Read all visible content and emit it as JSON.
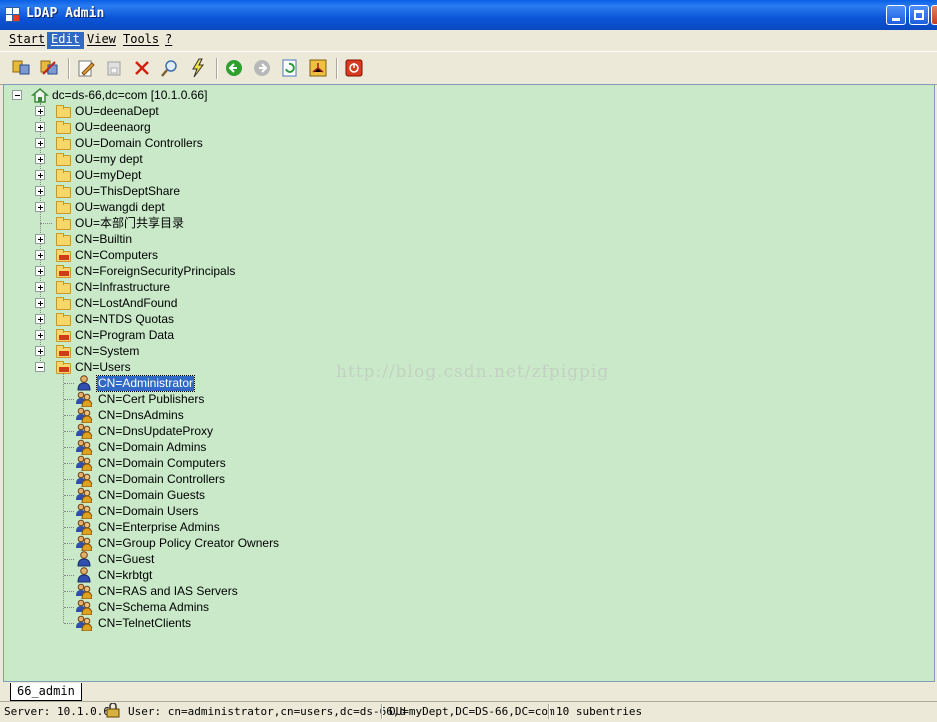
{
  "window": {
    "title": "LDAP Admin"
  },
  "menu": [
    {
      "label": "Start"
    },
    {
      "label": "Edit"
    },
    {
      "label": "View"
    },
    {
      "label": "Tools"
    },
    {
      "label": "?"
    }
  ],
  "toolbar": {
    "buttons": [
      "connect-icon",
      "disconnect-icon",
      "edit-icon",
      "save-icon",
      "delete-icon",
      "search-icon",
      "lightning-icon",
      "back-icon",
      "forward-icon",
      "refresh-icon",
      "schema-icon",
      "exit-icon"
    ]
  },
  "tree": {
    "root": "dc=ds-66,dc=com [10.1.0.66]",
    "children": [
      "OU=deenaDept",
      "OU=deenaorg",
      "OU=Domain Controllers",
      "OU=my dept",
      "OU=myDept",
      "OU=ThisDeptShare",
      "OU=wangdi dept",
      "OU=本部门共享目录",
      "CN=Builtin",
      "CN=Computers",
      "CN=ForeignSecurityPrincipals",
      "CN=Infrastructure",
      "CN=LostAndFound",
      "CN=NTDS Quotas",
      "CN=Program Data",
      "CN=System",
      "CN=Users"
    ],
    "users": [
      "CN=Administrator",
      "CN=Cert Publishers",
      "CN=DnsAdmins",
      "CN=DnsUpdateProxy",
      "CN=Domain Admins",
      "CN=Domain Computers",
      "CN=Domain Controllers",
      "CN=Domain Guests",
      "CN=Domain Users",
      "CN=Enterprise Admins",
      "CN=Group Policy Creator Owners",
      "CN=Guest",
      "CN=krbtgt",
      "CN=RAS and IAS Servers",
      "CN=Schema Admins",
      "CN=TelnetClients"
    ],
    "selected": "CN=Administrator"
  },
  "watermark": "http://blog.csdn.net/zfpigpig",
  "tab": {
    "label": "66_admin"
  },
  "status": {
    "server": "Server: 10.1.0.6",
    "user": "User: cn=administrator,cn=users,dc=ds-66,d",
    "dn": "OU=myDept,DC=DS-66,DC=com",
    "entries": "10 subentries"
  }
}
